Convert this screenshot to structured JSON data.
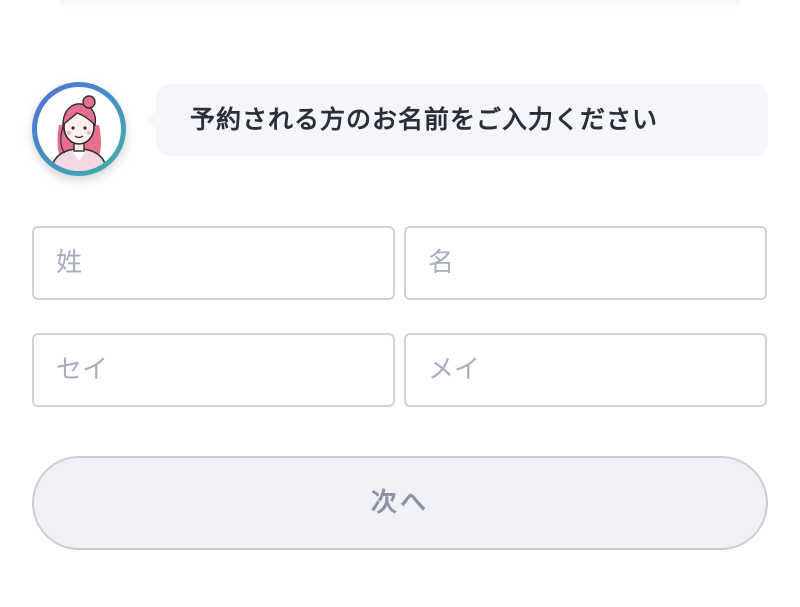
{
  "chat": {
    "message": "予約される方のお名前をご入力ください"
  },
  "form": {
    "last_name_placeholder": "姓",
    "first_name_placeholder": "名",
    "last_name_kana_placeholder": "セイ",
    "first_name_kana_placeholder": "メイ",
    "last_name_value": "",
    "first_name_value": "",
    "last_name_kana_value": "",
    "first_name_kana_value": ""
  },
  "actions": {
    "next_label": "次へ",
    "next_enabled": false
  },
  "colors": {
    "avatar_ring_start": "#4f6fd8",
    "avatar_ring_end": "#3fb2a9",
    "bubble_bg": "#f4f6fb",
    "input_border": "#cdd2e0",
    "button_bg": "#eff1f6",
    "button_text": "#8a90a8"
  },
  "icons": {
    "avatar": "woman-avatar-icon"
  }
}
